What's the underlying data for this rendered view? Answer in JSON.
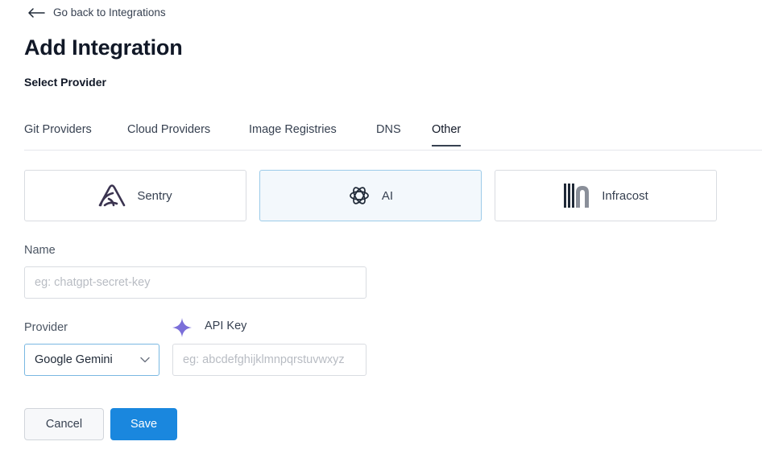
{
  "back_link": {
    "label": "Go back to Integrations",
    "icon": "arrow-left-icon"
  },
  "page_title": "Add Integration",
  "section_label": "Select Provider",
  "tabs": [
    {
      "label": "Git Providers",
      "active": false
    },
    {
      "label": "Cloud Providers",
      "active": false
    },
    {
      "label": "Image Registries",
      "active": false
    },
    {
      "label": "DNS",
      "active": false
    },
    {
      "label": "Other",
      "active": true
    }
  ],
  "providers": [
    {
      "label": "Sentry",
      "icon": "sentry-icon",
      "selected": false
    },
    {
      "label": "AI",
      "icon": "openai-icon",
      "selected": true
    },
    {
      "label": "Infracost",
      "icon": "infracost-icon",
      "selected": false
    }
  ],
  "form": {
    "name": {
      "label": "Name",
      "placeholder": "eg: chatgpt-secret-key",
      "value": ""
    },
    "provider": {
      "label": "Provider",
      "value": "Google Gemini"
    },
    "api_key": {
      "label": "API Key",
      "placeholder": "eg: abcdefghijklmnpqrstuvwxyz",
      "value": "",
      "icon": "gemini-sparkle-icon"
    }
  },
  "actions": {
    "cancel_label": "Cancel",
    "save_label": "Save"
  },
  "colors": {
    "primary": "#1a87de",
    "selected_bg": "#f3f8fc",
    "selected_border": "#9ccbe9",
    "gemini": "#7b6fd9"
  }
}
